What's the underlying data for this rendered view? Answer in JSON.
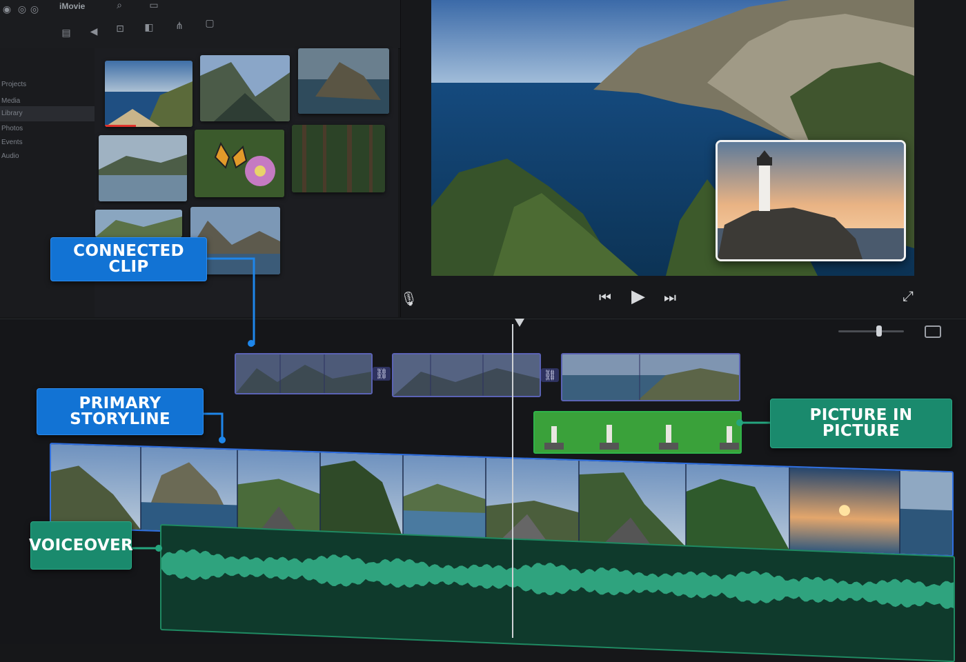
{
  "app": {
    "title": "iMovie"
  },
  "sidebar": {
    "items": [
      "Projects",
      "Media",
      "Library",
      "Photos",
      "Events",
      "Audio"
    ]
  },
  "callouts": {
    "connected_clip": "CONNECTED CLIP",
    "primary_storyline": "PRIMARY STORYLINE",
    "picture_in_picture": "PICTURE IN PICTURE",
    "voiceover": "VOICEOVER"
  },
  "colors": {
    "callout_blue": "#1273d4",
    "callout_teal": "#1a8a6d",
    "connected_clip": "#5b63b5",
    "primary_storyline": "#2f6fe0",
    "pip_clip": "#3aa13a",
    "voiceover_wave": "#2fa37e"
  },
  "icons": {
    "toolbar": [
      "grid-icon",
      "audio-icon",
      "crop-icon",
      "color-icon",
      "filter-icon",
      "info-icon"
    ],
    "transport": [
      "microphone-icon",
      "skip-back-icon",
      "play-icon",
      "skip-forward-icon",
      "fullscreen-icon"
    ],
    "timeline": [
      "link-icon",
      "zoom-slider",
      "display-icon"
    ]
  }
}
